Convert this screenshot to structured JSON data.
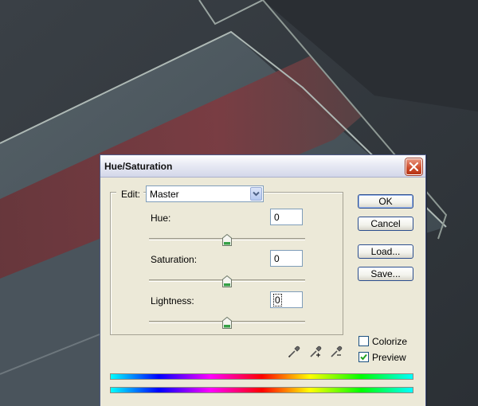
{
  "dialog": {
    "title": "Hue/Saturation",
    "close_icon": "close-icon",
    "edit_label": "Edit:",
    "edit_value": "Master",
    "sliders": [
      {
        "label": "Hue:",
        "value": "0",
        "position": 0.5
      },
      {
        "label": "Saturation:",
        "value": "0",
        "position": 0.5
      },
      {
        "label": "Lightness:",
        "value": "0",
        "position": 0.5
      }
    ],
    "buttons": {
      "ok": "OK",
      "cancel": "Cancel",
      "load": "Load...",
      "save": "Save..."
    },
    "colorize": {
      "label": "Colorize",
      "checked": false
    },
    "preview": {
      "label": "Preview",
      "checked": true
    },
    "eyedroppers": [
      "eyedropper-icon",
      "eyedropper-plus-icon",
      "eyedropper-minus-icon"
    ],
    "colors": {
      "title_text": "#101010",
      "dialog_bg": "#ece9d8",
      "close_button": "#cf4f2f",
      "slider_thumb": "#35a046",
      "check_mark": "#21a121"
    }
  }
}
